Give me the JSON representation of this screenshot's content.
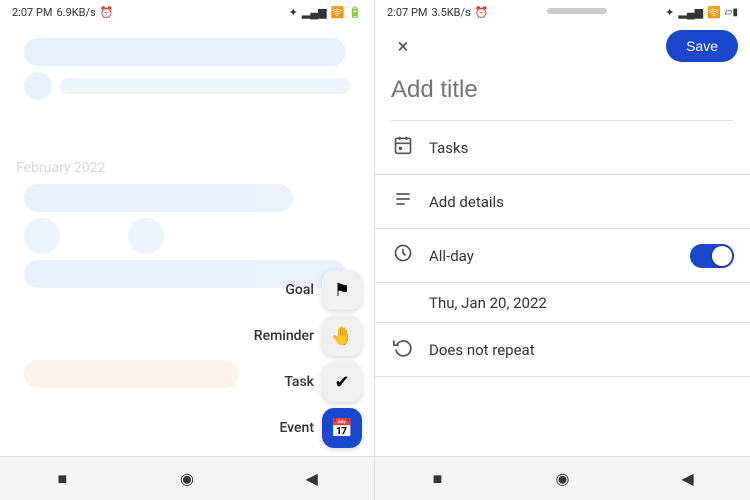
{
  "left": {
    "status": {
      "time": "2:07 PM",
      "data": "6.9KB/s",
      "alarm_icon": "⏰"
    },
    "month_label": "February 2022",
    "menu": {
      "items": [
        {
          "label": "Goal",
          "icon": "⚑",
          "active": false
        },
        {
          "label": "Reminder",
          "icon": "🤚",
          "active": false
        },
        {
          "label": "Task",
          "icon": "✔",
          "active": false
        },
        {
          "label": "Event",
          "icon": "📅",
          "active": true
        }
      ]
    },
    "nav": {
      "square": "■",
      "circle": "◉",
      "back": "◀"
    }
  },
  "right": {
    "status": {
      "time": "2:07 PM",
      "data": "3.5KB/s",
      "alarm_icon": "⏰"
    },
    "top_bar": {
      "close_label": "×",
      "save_label": "Save"
    },
    "title_placeholder": "Add title",
    "rows": [
      {
        "id": "tasks",
        "icon": "📅",
        "label": "Tasks",
        "has_toggle": false,
        "has_right": false
      },
      {
        "id": "details",
        "icon": "≡",
        "label": "Add details",
        "has_toggle": false,
        "has_right": false
      },
      {
        "id": "allday",
        "icon": "🕐",
        "label": "All-day",
        "has_toggle": true,
        "toggle_on": true
      },
      {
        "id": "date",
        "label": "Thu, Jan 20, 2022",
        "is_date": true
      },
      {
        "id": "repeat",
        "icon": "↺",
        "label": "Does not repeat",
        "has_toggle": false,
        "has_right": false
      }
    ],
    "nav": {
      "square": "■",
      "circle": "◉",
      "back": "◀"
    }
  }
}
